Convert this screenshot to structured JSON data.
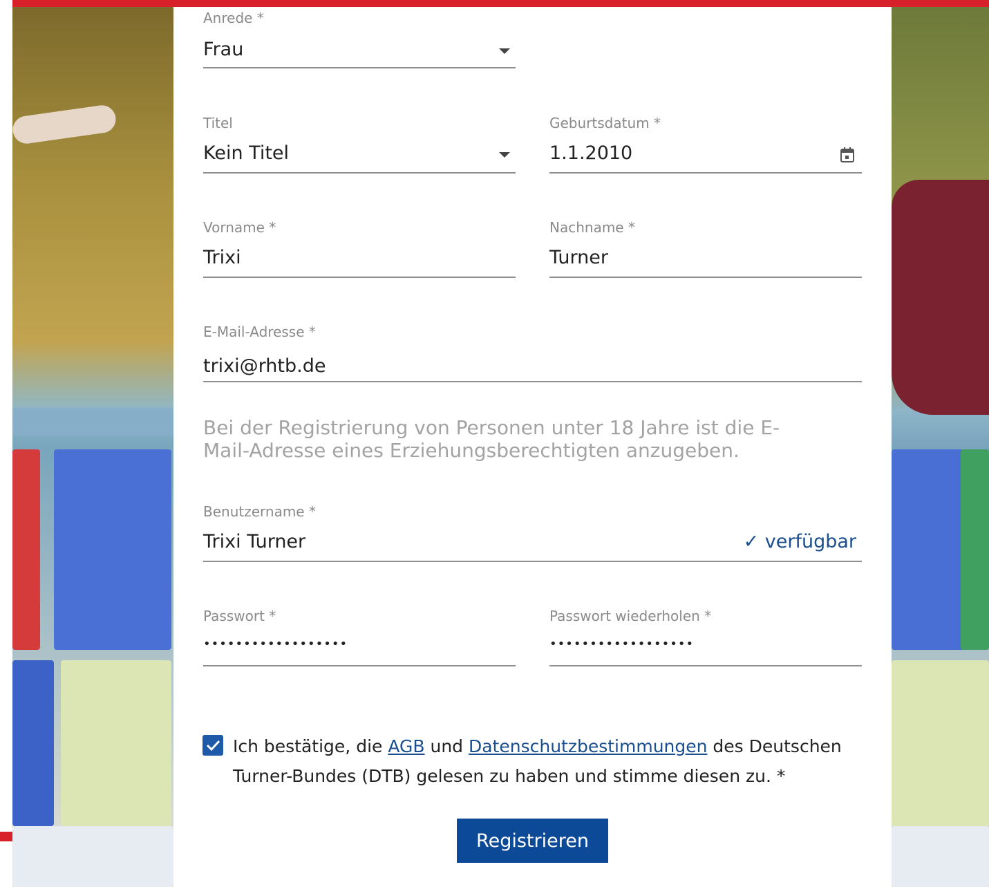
{
  "form": {
    "salutation": {
      "label": "Anrede *",
      "value": "Frau"
    },
    "title": {
      "label": "Titel",
      "value": "Kein Titel"
    },
    "birthdate": {
      "label": "Geburtsdatum *",
      "value": "1.1.2010"
    },
    "first_name": {
      "label": "Vorname *",
      "value": "Trixi"
    },
    "last_name": {
      "label": "Nachname *",
      "value": "Turner"
    },
    "email": {
      "label": "E-Mail-Adresse *",
      "value": "trixi@rhtb.de"
    },
    "email_hint": "Bei der Registrierung von Personen unter 18 Jahre ist die E-Mail-Adresse eines Erziehungsberechtigten anzugeben.",
    "username": {
      "label": "Benutzername *",
      "value": "Trixi Turner",
      "status": "✓ verfügbar"
    },
    "password": {
      "label": "Passwort *",
      "value": "••••••••••••••••••"
    },
    "password_repeat": {
      "label": "Passwort wiederholen *",
      "value": "••••••••••••••••••"
    },
    "consent": {
      "checked": true,
      "text_before": "Ich bestätige, die ",
      "agb_link": "AGB",
      "text_and": " und ",
      "privacy_link": "Datenschutzbestimmungen",
      "text_after": " des Deutschen Turner-Bundes (DTB) gelesen zu haben und stimme diesen zu. *"
    },
    "submit_label": "Registrieren"
  },
  "colors": {
    "accent_red": "#d8202a",
    "primary_blue": "#0c4a97",
    "link_blue": "#1a4f8f",
    "checkbox_blue": "#1e5aa8"
  }
}
